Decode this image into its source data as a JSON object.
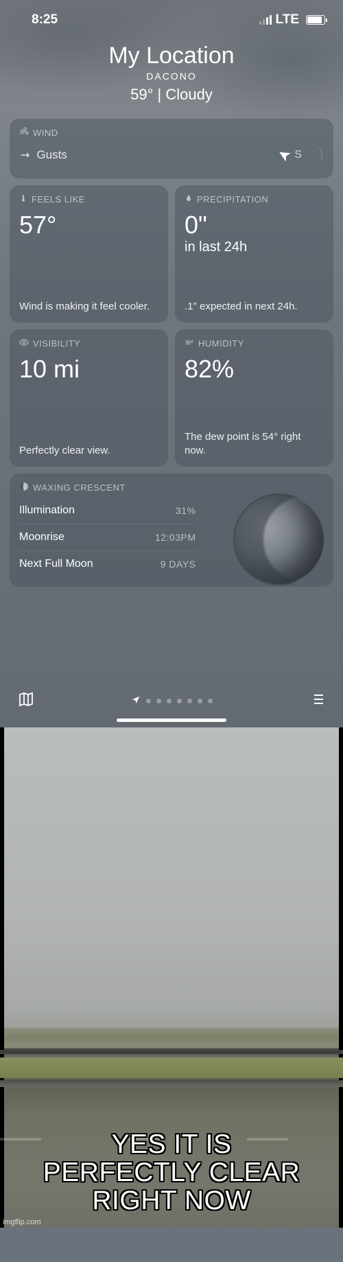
{
  "status": {
    "time": "8:25",
    "network": "LTE"
  },
  "header": {
    "title": "My Location",
    "subtitle": "DACONO",
    "summary": "59°  |  Cloudy"
  },
  "wind": {
    "label": "WIND",
    "gusts_label": "Gusts",
    "direction_letter": "S"
  },
  "feels": {
    "label": "FEELS LIKE",
    "value": "57°",
    "note": "Wind is making it feel cooler."
  },
  "precip": {
    "label": "PRECIPITATION",
    "value": "0\"",
    "subvalue": "in last 24h",
    "note": ".1\" expected in next 24h."
  },
  "visibility": {
    "label": "VISIBILITY",
    "value": "10 mi",
    "note": "Perfectly clear view."
  },
  "humidity": {
    "label": "HUMIDITY",
    "value": "82%",
    "note": "The dew point is 54° right now."
  },
  "moon": {
    "label": "WAXING CRESCENT",
    "rows": [
      {
        "k": "Illumination",
        "v": "31%"
      },
      {
        "k": "Moonrise",
        "v": "12:03PM"
      },
      {
        "k": "Next Full Moon",
        "v": "9 DAYS"
      }
    ]
  },
  "caption": {
    "line1": "YES IT IS",
    "line2": "PERFECTLY CLEAR RIGHT NOW"
  },
  "watermark": "imgflip.com"
}
